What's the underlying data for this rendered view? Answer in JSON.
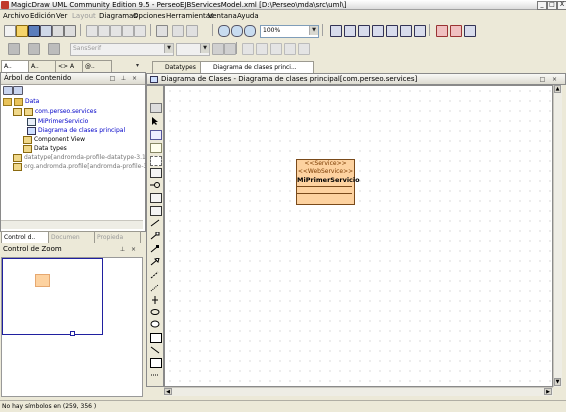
{
  "window": {
    "title": "MagicDraw UML Community Edition 9.5 - PerseoEJBServicesModel.xml [D:\\Perseo\\mda\\src\\uml\\]",
    "controls": [
      "_",
      "□",
      "X"
    ]
  },
  "menu": {
    "items": [
      {
        "label": "Archivo",
        "disabled": false
      },
      {
        "label": "Edición",
        "disabled": false
      },
      {
        "label": "Ver",
        "disabled": false
      },
      {
        "label": "Layout",
        "disabled": true
      },
      {
        "label": "Diagramas",
        "disabled": false
      },
      {
        "label": "Opciones",
        "disabled": false
      },
      {
        "label": "Herramientas",
        "disabled": false
      },
      {
        "label": "Ventana",
        "disabled": false
      },
      {
        "label": "Ayuda",
        "disabled": false
      }
    ]
  },
  "toolbar": {
    "zoom_value": "100%",
    "font_value": "SansSerif"
  },
  "left_panel": {
    "tabs": [
      "A..",
      "A..",
      "<> A",
      "@.."
    ],
    "tree_title": "Árbol de Contenido",
    "tree": [
      {
        "label": "Data",
        "color": "#0000c8",
        "indent": 0,
        "icon": "folder-icon"
      },
      {
        "label": "com.perseo.services",
        "color": "#0000c8",
        "indent": 1,
        "icon": "package-icon"
      },
      {
        "label": "MiPrimerServicio",
        "color": "#0000c8",
        "indent": 2,
        "icon": "class-icon"
      },
      {
        "label": "Diagrama de clases principal",
        "color": "#0000c8",
        "indent": 2,
        "icon": "diagram-icon"
      },
      {
        "label": "Component View",
        "color": "#000000",
        "indent": 1,
        "icon": "package-icon"
      },
      {
        "label": "Data types",
        "color": "#000000",
        "indent": 1,
        "icon": "package-icon"
      },
      {
        "label": "datatype[andromda-profile-datatype-3.1-",
        "color": "#777777",
        "indent": 0,
        "icon": "package-icon"
      },
      {
        "label": "org.andromda.profile[andromda-profile-3.",
        "color": "#777777",
        "indent": 0,
        "icon": "package-icon"
      }
    ],
    "bottom_tabs": [
      "Control d..",
      "Documen",
      "Propieda"
    ],
    "zoom_title": "Control de Zoom"
  },
  "diagram": {
    "tabs": [
      "Datatypes",
      "Diagrama de clases princi..."
    ],
    "header": "Diagrama de Clases - Diagrama de clases principal[com.perseo.services]",
    "class_box": {
      "stereotypes": [
        "<<Service>>",
        "<<WebService>>"
      ],
      "name": "MiPrimerServicio"
    }
  },
  "status": {
    "text": "No hay símbolos en (259, 356 )"
  },
  "colors": {
    "background": "#ece9d8",
    "class_fill": "#fdd2a0",
    "link": "#0000c8"
  }
}
